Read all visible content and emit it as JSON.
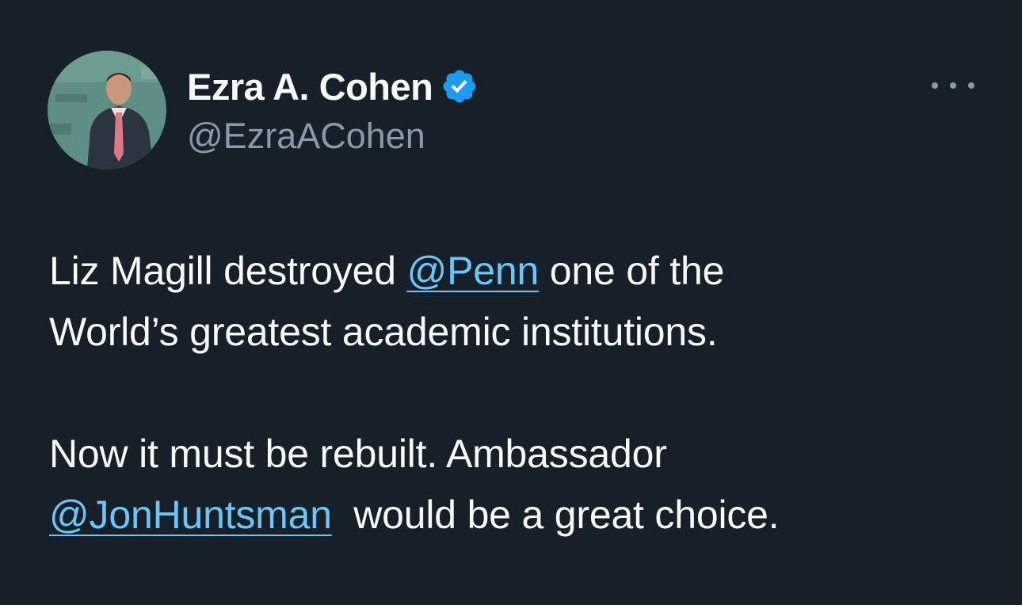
{
  "author": {
    "display_name": "Ezra A. Cohen",
    "handle": "@EzraACohen",
    "verified": true,
    "avatar_icon": "profile-photo"
  },
  "menu": {
    "icon": "more-options-icon"
  },
  "tweet": {
    "paragraph1": {
      "text_before": "Liz Magill destroyed ",
      "mention": "@Penn",
      "text_line1_after": " one of the",
      "text_line2": "World’s greatest academic institutions."
    },
    "paragraph2": {
      "text_line1": "Now it must be rebuilt. Ambassador",
      "mention": "@JonHuntsman",
      "text_line2_after": "  would be a great choice."
    }
  },
  "colors": {
    "background": "#172029",
    "text": "#f7f9f9",
    "secondary_text": "#8b98a5",
    "link": "#6cc4f7",
    "verified_badge": "#1d9bf0"
  }
}
